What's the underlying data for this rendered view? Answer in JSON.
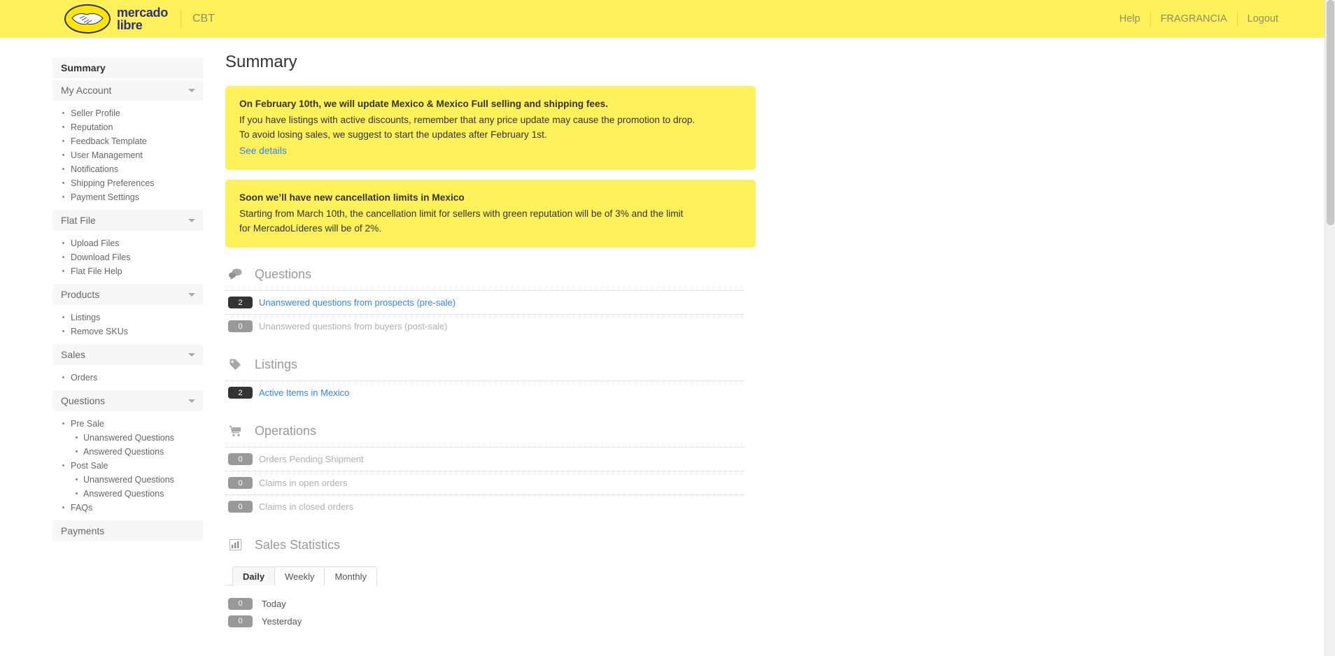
{
  "header": {
    "brand_line1": "mercado",
    "brand_line2": "libre",
    "brand_sub": "CBT",
    "links": [
      {
        "label": "Help",
        "name": "help-link"
      },
      {
        "label": "FRAGRANCIA",
        "name": "account-link"
      },
      {
        "label": "Logout",
        "name": "logout-link"
      }
    ]
  },
  "sidebar": {
    "groups": [
      {
        "label": "Summary",
        "active": true,
        "caret": false,
        "items": []
      },
      {
        "label": "My Account",
        "active": false,
        "caret": true,
        "items": [
          {
            "label": "Seller Profile"
          },
          {
            "label": "Reputation"
          },
          {
            "label": "Feedback Template"
          },
          {
            "label": "User Management"
          },
          {
            "label": "Notifications"
          },
          {
            "label": "Shipping Preferences"
          },
          {
            "label": "Payment Settings"
          }
        ]
      },
      {
        "label": "Flat File",
        "active": false,
        "caret": true,
        "items": [
          {
            "label": "Upload Files"
          },
          {
            "label": "Download Files"
          },
          {
            "label": "Flat File Help"
          }
        ]
      },
      {
        "label": "Products",
        "active": false,
        "caret": true,
        "items": [
          {
            "label": "Listings"
          },
          {
            "label": "Remove SKUs"
          }
        ]
      },
      {
        "label": "Sales",
        "active": false,
        "caret": true,
        "items": [
          {
            "label": "Orders"
          }
        ]
      },
      {
        "label": "Questions",
        "active": false,
        "caret": true,
        "items": [
          {
            "label": "Pre Sale"
          },
          {
            "label": "Unanswered Questions",
            "sub": true
          },
          {
            "label": "Answered Questions",
            "sub": true
          },
          {
            "label": "Post Sale"
          },
          {
            "label": "Unanswered Questions",
            "sub": true
          },
          {
            "label": "Answered Questions",
            "sub": true
          },
          {
            "label": "FAQs"
          }
        ]
      },
      {
        "label": "Payments",
        "active": false,
        "caret": false,
        "items": []
      }
    ]
  },
  "main": {
    "page_title": "Summary",
    "banners": [
      {
        "title": "On February 10th, we will update Mexico & Mexico Full selling and shipping fees.",
        "lines": [
          "If you have listings with active discounts, remember that any price update may cause the promotion to drop.",
          "To avoid losing sales, we suggest to start the updates after February 1st."
        ],
        "link": "See details"
      },
      {
        "title": "Soon we’ll have new cancellation limits in Mexico",
        "lines": [
          "Starting from March 10th, the cancellation limit for sellers with green reputation will be of 3% and the limit",
          "for MercadoLíderes will be of 2%."
        ],
        "link": ""
      }
    ],
    "sections": [
      {
        "title": "Questions",
        "icon": "chat-bubbles-icon",
        "rows": [
          {
            "count": "2",
            "label": "Unanswered questions from prospects (pre-sale)",
            "style": "link",
            "badge": "dark"
          },
          {
            "count": "0",
            "label": "Unanswered questions from buyers (post-sale)",
            "style": "muted",
            "badge": "muted"
          }
        ]
      },
      {
        "title": "Listings",
        "icon": "tag-icon",
        "rows": [
          {
            "count": "2",
            "label": "Active Items in Mexico",
            "style": "link",
            "badge": "dark"
          }
        ]
      },
      {
        "title": "Operations",
        "icon": "cart-icon",
        "rows": [
          {
            "count": "0",
            "label": "Orders Pending Shipment",
            "style": "muted",
            "badge": "muted"
          },
          {
            "count": "0",
            "label": "Claims in open orders",
            "style": "muted",
            "badge": "muted"
          },
          {
            "count": "0",
            "label": "Claims in closed orders",
            "style": "muted",
            "badge": "muted"
          }
        ]
      }
    ],
    "sales_statistics": {
      "title": "Sales Statistics",
      "icon": "bar-chart-icon",
      "tabs": [
        {
          "label": "Daily",
          "active": true
        },
        {
          "label": "Weekly",
          "active": false
        },
        {
          "label": "Monthly",
          "active": false
        }
      ],
      "rows": [
        {
          "count": "0",
          "label": "Today"
        },
        {
          "count": "0",
          "label": "Yesterday"
        }
      ]
    }
  },
  "colors": {
    "brand_yellow": "#fff159",
    "brand_blue": "#2d3277",
    "link_blue": "#3483fa",
    "badge_dark": "#333333",
    "badge_muted": "#999999"
  }
}
